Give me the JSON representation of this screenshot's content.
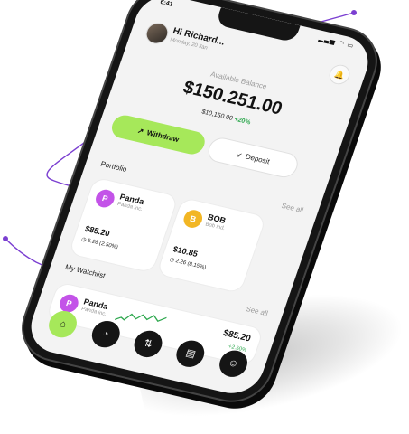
{
  "status": {
    "time": "6:41",
    "icons": "▂▃▅ ◠ ▭"
  },
  "header": {
    "greeting": "Hi Richard...",
    "date": "Monday, 20 Jan",
    "bell_icon": "🔔"
  },
  "balance": {
    "label": "Available Balance",
    "amount": "$150.251.00",
    "sub_amount": "$10,150.00",
    "sub_change": "+20%"
  },
  "actions": {
    "withdraw_label": "Withdraw",
    "deposit_label": "Deposit"
  },
  "portfolio": {
    "title": "Portfolio",
    "see_all": "See all",
    "cards": [
      {
        "letter": "P",
        "name": "Panda",
        "company": "Panda inc.",
        "price": "$85.20",
        "change": "5.26 (2.50%)"
      },
      {
        "letter": "B",
        "name": "BOB",
        "company": "Bob ind.",
        "price": "$10.85",
        "change": "2.26 (8.15%)"
      }
    ]
  },
  "watchlist": {
    "title": "My Watchlist",
    "see_all": "See all",
    "items": [
      {
        "letter": "P",
        "name": "Panda",
        "company": "Panda inc.",
        "price": "$85.20",
        "change": "+2.50%"
      }
    ]
  },
  "nav": {
    "items": [
      {
        "icon": "home-icon",
        "glyph": "⌂"
      },
      {
        "icon": "chart-icon",
        "glyph": "◔"
      },
      {
        "icon": "swap-icon",
        "glyph": "⇅"
      },
      {
        "icon": "wallet-icon",
        "glyph": "▤"
      },
      {
        "icon": "profile-icon",
        "glyph": "☺"
      }
    ]
  },
  "colors": {
    "accent": "#a6e85a",
    "curve": "#7b3fd1",
    "positive": "#2fa84f"
  }
}
